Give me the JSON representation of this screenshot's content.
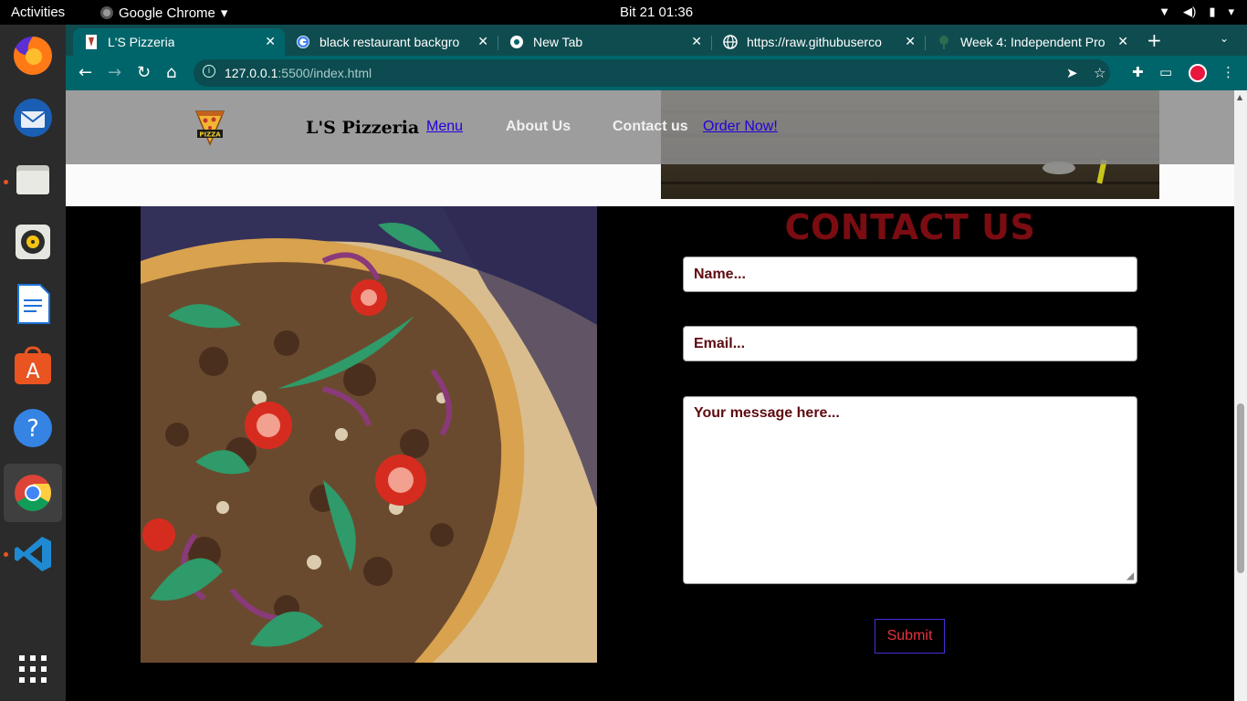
{
  "desktop": {
    "activities": "Activities",
    "app_name": "Google Chrome",
    "clock": "Bit 21  01:36"
  },
  "dock": [
    {
      "name": "firefox-icon"
    },
    {
      "name": "thunderbird-icon"
    },
    {
      "name": "files-icon"
    },
    {
      "name": "rhythmbox-icon"
    },
    {
      "name": "writer-icon"
    },
    {
      "name": "software-center-icon"
    },
    {
      "name": "help-icon"
    },
    {
      "name": "chrome-icon"
    },
    {
      "name": "vscode-icon"
    },
    {
      "name": "app-grid-icon"
    }
  ],
  "browser": {
    "tabs": [
      {
        "title": "L'S Pizzeria",
        "active": true
      },
      {
        "title": "black restaurant backgro"
      },
      {
        "title": "New Tab"
      },
      {
        "title": "https://raw.githubuserco"
      },
      {
        "title": "Week 4: Independent Pro"
      }
    ],
    "url_host": "127.0.0.1",
    "url_rest": ":5500/index.html"
  },
  "site": {
    "logo_text": "PIZZA",
    "brand": "L'S Pizzeria",
    "nav": {
      "menu": "Menu",
      "about": "About Us",
      "contact": "Contact us",
      "order": "Order Now!"
    },
    "contact": {
      "title": "CONTACT US",
      "name_placeholder": "Name...",
      "email_placeholder": "Email...",
      "message_placeholder": "Your message here...",
      "submit": "Submit"
    }
  },
  "colors": {
    "accent_title": "#7a0c12",
    "chrome_tabbar": "#0f4c4f",
    "chrome_toolbar": "#00656a",
    "submit_text": "#e8313f"
  }
}
